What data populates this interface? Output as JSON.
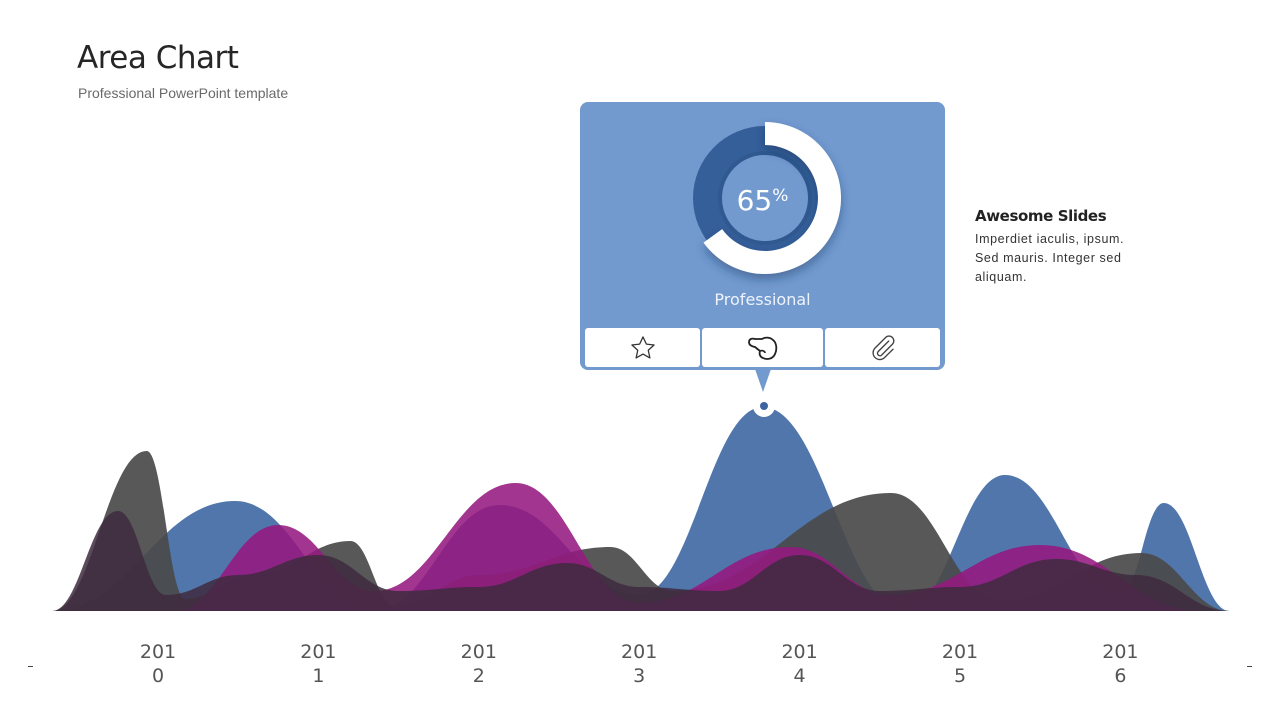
{
  "header": {
    "title": "Area Chart",
    "subtitle": "Professional PowerPoint template"
  },
  "card": {
    "percent_value": "65",
    "percent_sign": "%",
    "progress": 0.65,
    "label": "Professional",
    "buttons": [
      {
        "icon": "star-icon"
      },
      {
        "icon": "pointing-hand-icon"
      },
      {
        "icon": "paperclip-icon"
      }
    ],
    "colors": {
      "card": "#729acf",
      "ring_dark": "#355f99",
      "ring_fill": "#ffffff"
    }
  },
  "side_note": {
    "title": "Awesome Slides",
    "text": "Imperdiet iaculis, ipsum. Sed  mauris. Integer sed aliquam."
  },
  "chart_data": {
    "type": "area",
    "title": "",
    "xlabel": "",
    "ylabel": "",
    "categories": [
      {
        "top": "201",
        "bottom": "0"
      },
      {
        "top": "201",
        "bottom": "1"
      },
      {
        "top": "201",
        "bottom": "2"
      },
      {
        "top": "201",
        "bottom": "3"
      },
      {
        "top": "201",
        "bottom": "4"
      },
      {
        "top": "201",
        "bottom": "5"
      },
      {
        "top": "201",
        "bottom": "6"
      }
    ],
    "xlim": [
      2009.34,
      2016.68
    ],
    "ylim": [
      0,
      110
    ],
    "grid": false,
    "legend": "none",
    "series": [
      {
        "color": "#4a72a8",
        "opacity": 0.97,
        "points": [
          [
            2009.34,
            0
          ],
          [
            2010.48,
            55
          ],
          [
            2011.35,
            0
          ],
          [
            2012.13,
            53
          ],
          [
            2013.0,
            8
          ],
          [
            2013.77,
            102
          ],
          [
            2014.66,
            0
          ],
          [
            2015.28,
            68
          ],
          [
            2016.0,
            8
          ],
          [
            2016.27,
            54
          ],
          [
            2016.68,
            0
          ]
        ]
      },
      {
        "color": "#4a4a4a",
        "opacity": 0.92,
        "points": [
          [
            2009.34,
            0
          ],
          [
            2009.93,
            80
          ],
          [
            2010.17,
            6
          ],
          [
            2010.6,
            18
          ],
          [
            2011.2,
            35
          ],
          [
            2011.48,
            2
          ],
          [
            2012.0,
            18
          ],
          [
            2012.82,
            32
          ],
          [
            2013.21,
            10
          ],
          [
            2014.57,
            59
          ],
          [
            2015.25,
            5
          ],
          [
            2016.13,
            29
          ],
          [
            2016.68,
            0
          ]
        ]
      },
      {
        "color": "#95197f",
        "opacity": 0.88,
        "points": [
          [
            2010.1,
            0
          ],
          [
            2010.75,
            43
          ],
          [
            2011.35,
            10
          ],
          [
            2012.23,
            64
          ],
          [
            2013.0,
            4
          ],
          [
            2013.94,
            32
          ],
          [
            2014.57,
            8
          ],
          [
            2015.5,
            33
          ],
          [
            2016.5,
            0
          ]
        ]
      },
      {
        "color": "#3e2a3e",
        "opacity": 0.85,
        "points": [
          [
            2009.34,
            0
          ],
          [
            2009.75,
            50
          ],
          [
            2010.05,
            8
          ],
          [
            2010.5,
            18
          ],
          [
            2011.0,
            28
          ],
          [
            2011.5,
            10
          ],
          [
            2012.0,
            12
          ],
          [
            2012.55,
            24
          ],
          [
            2013.0,
            12
          ],
          [
            2013.5,
            10
          ],
          [
            2014.0,
            28
          ],
          [
            2014.5,
            10
          ],
          [
            2015.0,
            12
          ],
          [
            2015.6,
            26
          ],
          [
            2016.1,
            18
          ],
          [
            2016.68,
            0
          ]
        ]
      }
    ]
  }
}
